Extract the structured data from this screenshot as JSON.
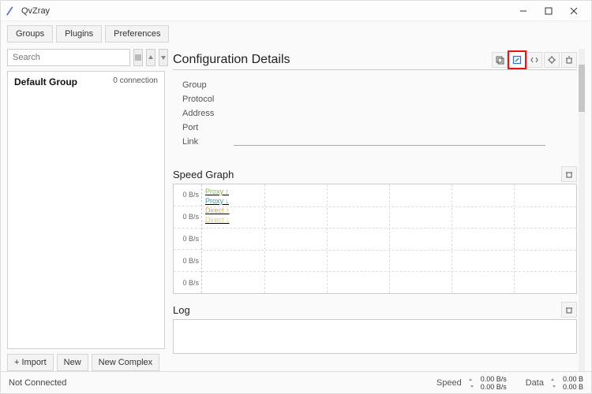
{
  "titlebar": {
    "title": "QvZray"
  },
  "toolbar": {
    "groups": "Groups",
    "plugins": "Plugins",
    "preferences": "Preferences"
  },
  "sidebar": {
    "search_placeholder": "Search",
    "group": {
      "name": "Default Group",
      "connections": "0 connection"
    },
    "bottom": {
      "import": "+ Import",
      "new": "New",
      "new_complex": "New Complex"
    }
  },
  "details": {
    "title": "Configuration Details",
    "rows": {
      "group": "Group",
      "protocol": "Protocol",
      "address": "Address",
      "port": "Port",
      "link": "Link"
    }
  },
  "speed": {
    "title": "Speed Graph",
    "yticks": [
      "0 B/s",
      "0 B/s",
      "0 B/s",
      "0 B/s",
      "0 B/s"
    ],
    "legend": [
      {
        "label": "Proxy ↑",
        "color": "#8bbf2f"
      },
      {
        "label": "Proxy ↓",
        "color": "#2ea3b8"
      },
      {
        "label": "Direct ↑",
        "color": "#e9a423"
      },
      {
        "label": "Direct ↓",
        "color": "#e5d24a"
      }
    ]
  },
  "log": {
    "title": "Log"
  },
  "status": {
    "state": "Not Connected",
    "speed_label": "Speed",
    "speed_up": "0.00 B/s",
    "speed_down": "0.00 B/s",
    "data_label": "Data",
    "data_up": "0.00 B",
    "data_down": "0.00 B"
  },
  "chart_data": {
    "type": "line",
    "title": "Speed Graph",
    "ylabel": "B/s",
    "ylim": [
      0,
      0
    ],
    "series": [
      {
        "name": "Proxy ↑",
        "values": []
      },
      {
        "name": "Proxy ↓",
        "values": []
      },
      {
        "name": "Direct ↑",
        "values": []
      },
      {
        "name": "Direct ↓",
        "values": []
      }
    ]
  }
}
